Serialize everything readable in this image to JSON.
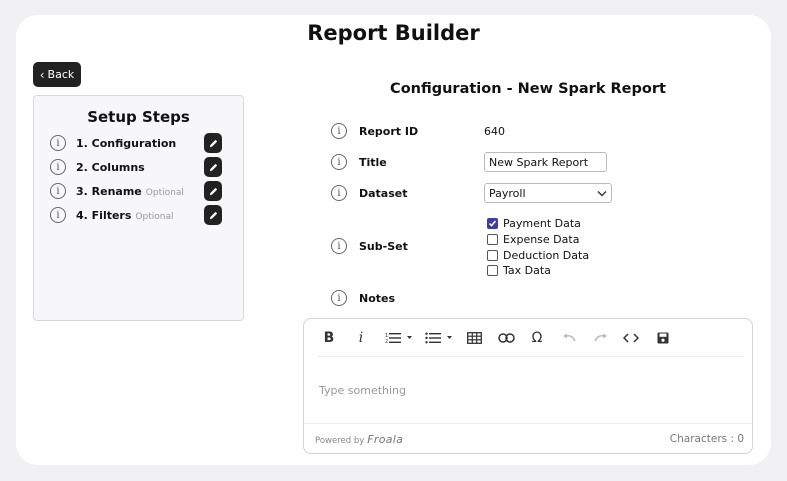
{
  "header": {
    "title": "Report Builder"
  },
  "back_button": {
    "label": "Back"
  },
  "setup_steps": {
    "title": "Setup Steps",
    "steps": [
      {
        "label": "1. Configuration",
        "optional": ""
      },
      {
        "label": "2. Columns",
        "optional": ""
      },
      {
        "label": "3. Rename",
        "optional": "Optional"
      },
      {
        "label": "4. Filters",
        "optional": "Optional"
      }
    ]
  },
  "form": {
    "title": "Configuration - New Spark Report",
    "report_id": {
      "label": "Report ID",
      "value": "640"
    },
    "title_field": {
      "label": "Title",
      "value": "New Spark Report"
    },
    "dataset": {
      "label": "Dataset",
      "value": "Payroll"
    },
    "subset": {
      "label": "Sub-Set",
      "options": [
        {
          "label": "Payment Data",
          "checked": true
        },
        {
          "label": "Expense Data",
          "checked": false
        },
        {
          "label": "Deduction Data",
          "checked": false
        },
        {
          "label": "Tax Data",
          "checked": false
        }
      ]
    },
    "notes": {
      "label": "Notes"
    }
  },
  "editor": {
    "placeholder": "Type something",
    "powered_by": "Powered by",
    "brand": "Froala",
    "characters_label": "Characters : 0",
    "toolbar_icons": [
      "bold-icon",
      "italic-icon",
      "ordered-list-icon",
      "unordered-list-icon",
      "table-icon",
      "link-icon",
      "special-character-icon",
      "undo-icon",
      "redo-icon",
      "code-view-icon",
      "save-icon"
    ]
  },
  "colors": {
    "accent": "#3c3fa0",
    "button_dark": "#222222"
  }
}
